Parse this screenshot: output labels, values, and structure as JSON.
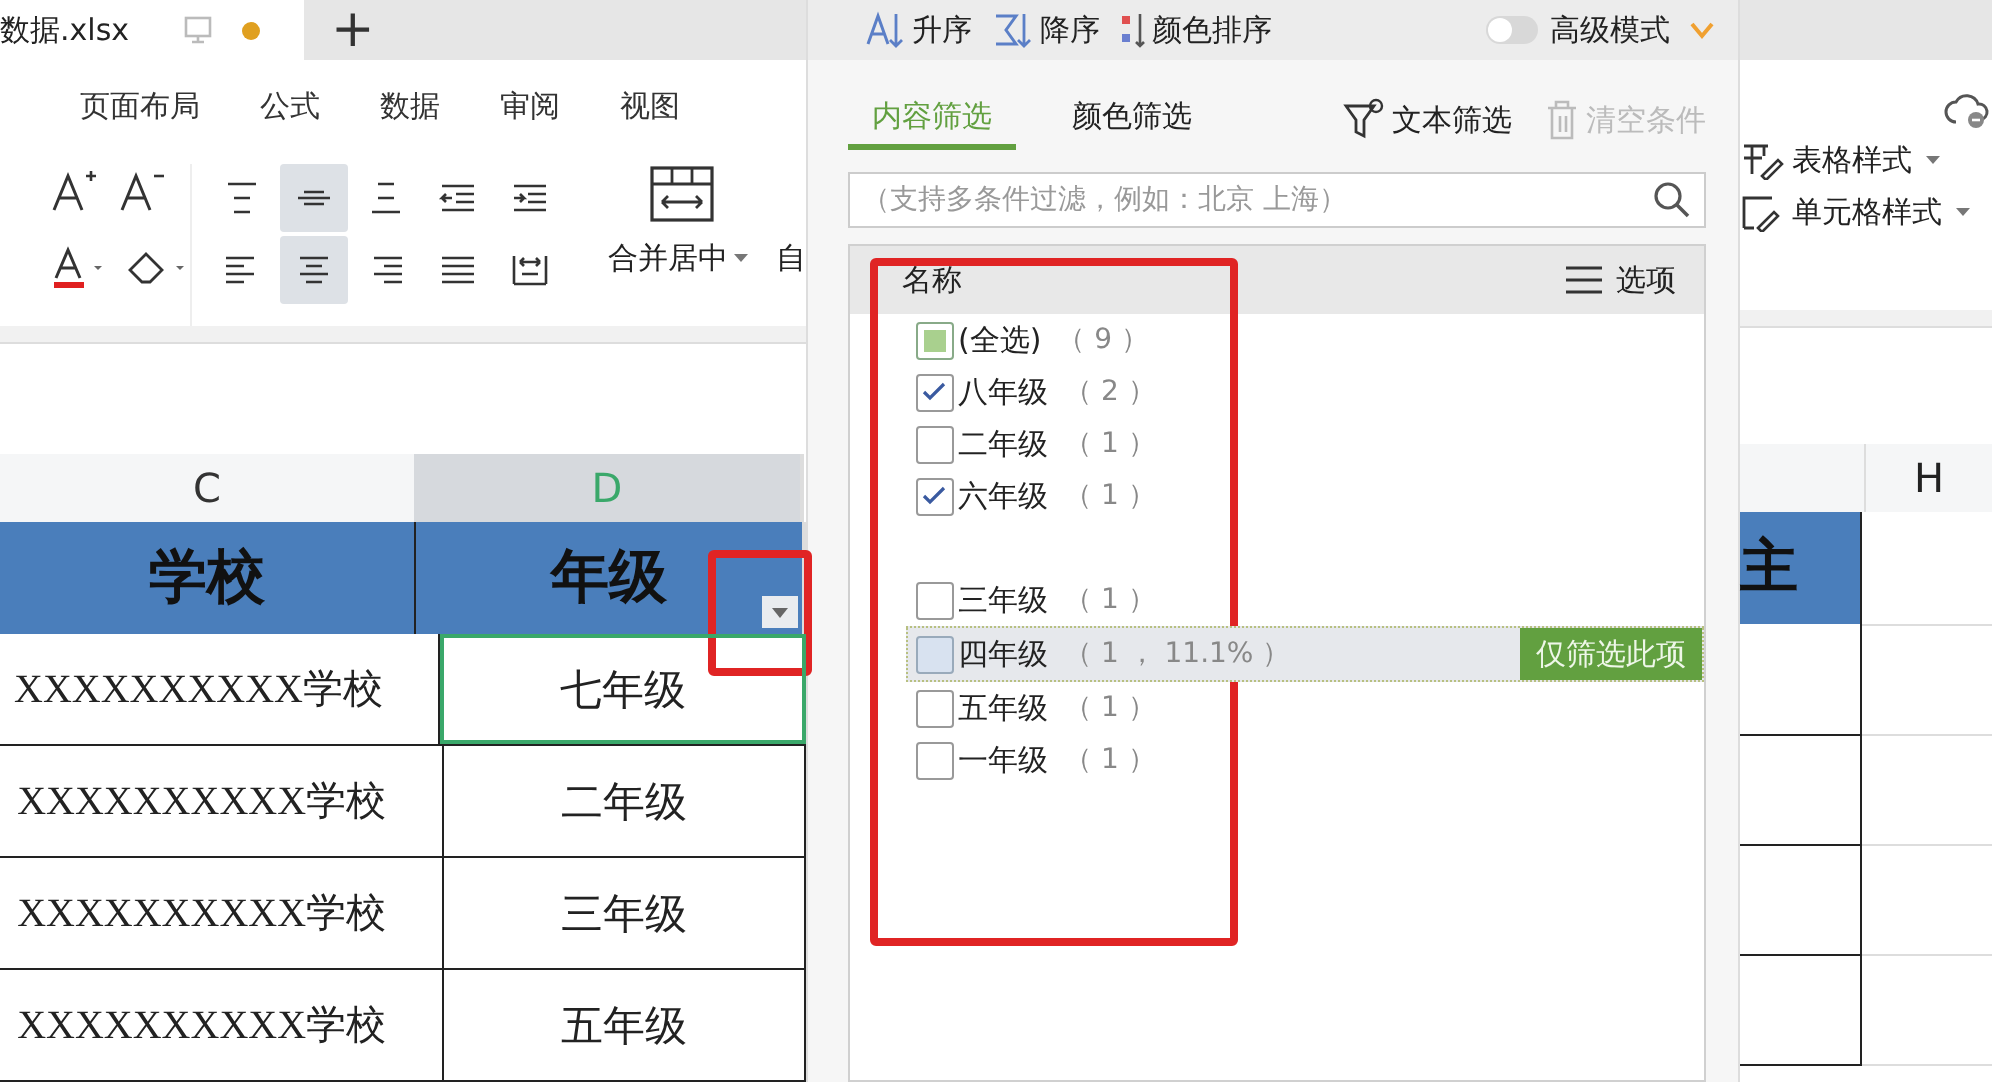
{
  "tabs": [
    {
      "label": "数据.xlsx",
      "selected": true,
      "modified": true
    }
  ],
  "new_tab": "+",
  "menu": [
    "页面布局",
    "公式",
    "数据",
    "审阅",
    "视图"
  ],
  "ribbon": {
    "align_buttons": [
      {
        "kind": "top",
        "selected": false
      },
      {
        "kind": "middle",
        "selected": true
      },
      {
        "kind": "bottom",
        "selected": false
      },
      {
        "kind": "outdent",
        "selected": false
      },
      {
        "kind": "indent",
        "selected": false
      },
      {
        "kind": "left",
        "selected": false
      },
      {
        "kind": "center",
        "selected": true
      },
      {
        "kind": "right",
        "selected": false
      },
      {
        "kind": "justify",
        "selected": false
      },
      {
        "kind": "distribute",
        "selected": false
      }
    ],
    "merge_label": "合并居中",
    "wrap_label": "自",
    "table_style": "表格样式",
    "cell_style": "单元格样式"
  },
  "sort_bar": {
    "ascending": "升序",
    "descending": "降序",
    "color_sort": "颜色排序",
    "advanced": {
      "label": "高级模式",
      "on": false
    }
  },
  "filter_tabs": [
    {
      "label": "内容筛选",
      "selected": true
    },
    {
      "label": "颜色筛选",
      "selected": false
    }
  ],
  "text_filter": "文本筛选",
  "clear": {
    "label": "清空条件",
    "disabled": true
  },
  "search": {
    "placeholder": "（支持多条件过滤，例如：北京 上海）"
  },
  "list": {
    "header": "名称",
    "options": "选项",
    "items": [
      {
        "label": "(全选)",
        "count": "（ 9 ）",
        "checked": false,
        "partial": true,
        "highlighted": false
      },
      {
        "label": "八年级",
        "count": "（ 2 ）",
        "checked": true,
        "partial": false,
        "highlighted": false
      },
      {
        "label": "二年级",
        "count": "（ 1 ）",
        "checked": false,
        "partial": false,
        "highlighted": false
      },
      {
        "label": "六年级",
        "count": "（ 1 ）",
        "checked": true,
        "partial": false,
        "highlighted": false
      },
      {
        "label": "三年级",
        "count": "（ 1 ）",
        "checked": false,
        "partial": false,
        "highlighted": false
      },
      {
        "label": "四年级",
        "count": "（ 1 ， 11.1% ）",
        "checked": false,
        "partial": false,
        "highlighted": true,
        "action": "仅筛选此项"
      },
      {
        "label": "五年级",
        "count": "（ 1 ）",
        "checked": false,
        "partial": false,
        "highlighted": false
      },
      {
        "label": "一年级",
        "count": "（ 1 ）",
        "checked": false,
        "partial": false,
        "highlighted": false
      }
    ]
  },
  "sheet": {
    "columns": [
      {
        "label": "C",
        "selected": false
      },
      {
        "label": "D",
        "selected": true
      }
    ],
    "header": [
      "学校",
      "年级"
    ],
    "rows": [
      [
        "XXXXXXXXXX学校",
        "七年级"
      ],
      [
        "XXXXXXXXXX学校",
        "二年级"
      ],
      [
        "XXXXXXXXXX学校",
        "三年级"
      ],
      [
        "XXXXXXXXXX学校",
        "五年级"
      ]
    ],
    "right_column": "H",
    "right_header": "主"
  }
}
